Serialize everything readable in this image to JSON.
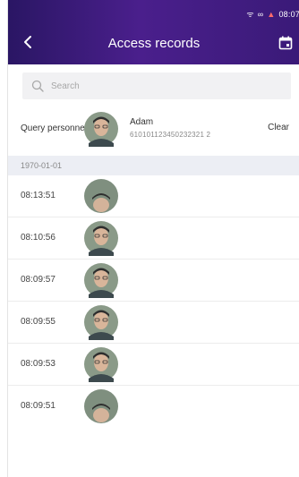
{
  "status": {
    "time": "08:07"
  },
  "header": {
    "title": "Access records"
  },
  "search": {
    "placeholder": "Search"
  },
  "query": {
    "label": "Query personnel",
    "name": "Adam",
    "id": "610101123450232321 2",
    "clear_label": "Clear"
  },
  "date_group": "1970-01-01",
  "records": [
    {
      "time": "08:13:51"
    },
    {
      "time": "08:10:56"
    },
    {
      "time": "08:09:57"
    },
    {
      "time": "08:09:55"
    },
    {
      "time": "08:09:53"
    },
    {
      "time": "08:09:51"
    }
  ],
  "colors": {
    "header_start": "#2a1664",
    "header_end": "#4a1f8c",
    "date_bar": "#eceef4"
  }
}
